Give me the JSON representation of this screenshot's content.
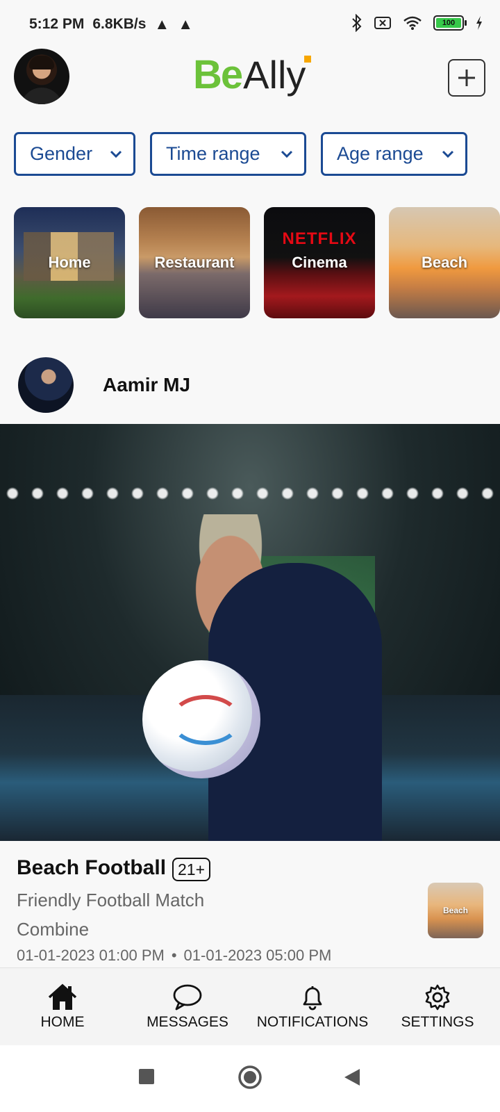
{
  "status_bar": {
    "time": "5:12 PM",
    "speed": "6.8KB/s",
    "battery": "100"
  },
  "header": {
    "logo_be": "Be",
    "logo_ally": "Ally",
    "icons": [
      "avatar",
      "plus-icon"
    ]
  },
  "filters": [
    {
      "label": "Gender"
    },
    {
      "label": "Time range"
    },
    {
      "label": "Age range"
    }
  ],
  "categories": [
    {
      "label": "Home"
    },
    {
      "label": "Restaurant"
    },
    {
      "label": "Cinema",
      "brand": "NETFLIX"
    },
    {
      "label": "Beach"
    }
  ],
  "post": {
    "author": "Aamir MJ",
    "title": "Beach Football",
    "age_badge": "21+",
    "description": "Friendly Football Match",
    "category": "Combine",
    "start": "01-01-2023 01:00 PM",
    "separator": "•",
    "end": "01-01-2023 05:00 PM",
    "thumb_label": "Beach"
  },
  "bottom_nav": [
    {
      "label": "HOME",
      "icon": "home-icon"
    },
    {
      "label": "MESSAGES",
      "icon": "chat-bubble-icon"
    },
    {
      "label": "NOTIFICATIONS",
      "icon": "bell-icon"
    },
    {
      "label": "SETTINGS",
      "icon": "gear-icon"
    }
  ],
  "colors": {
    "accent_blue": "#1b4a93",
    "logo_green": "#6cc23a",
    "battery_green": "#37c94a"
  }
}
